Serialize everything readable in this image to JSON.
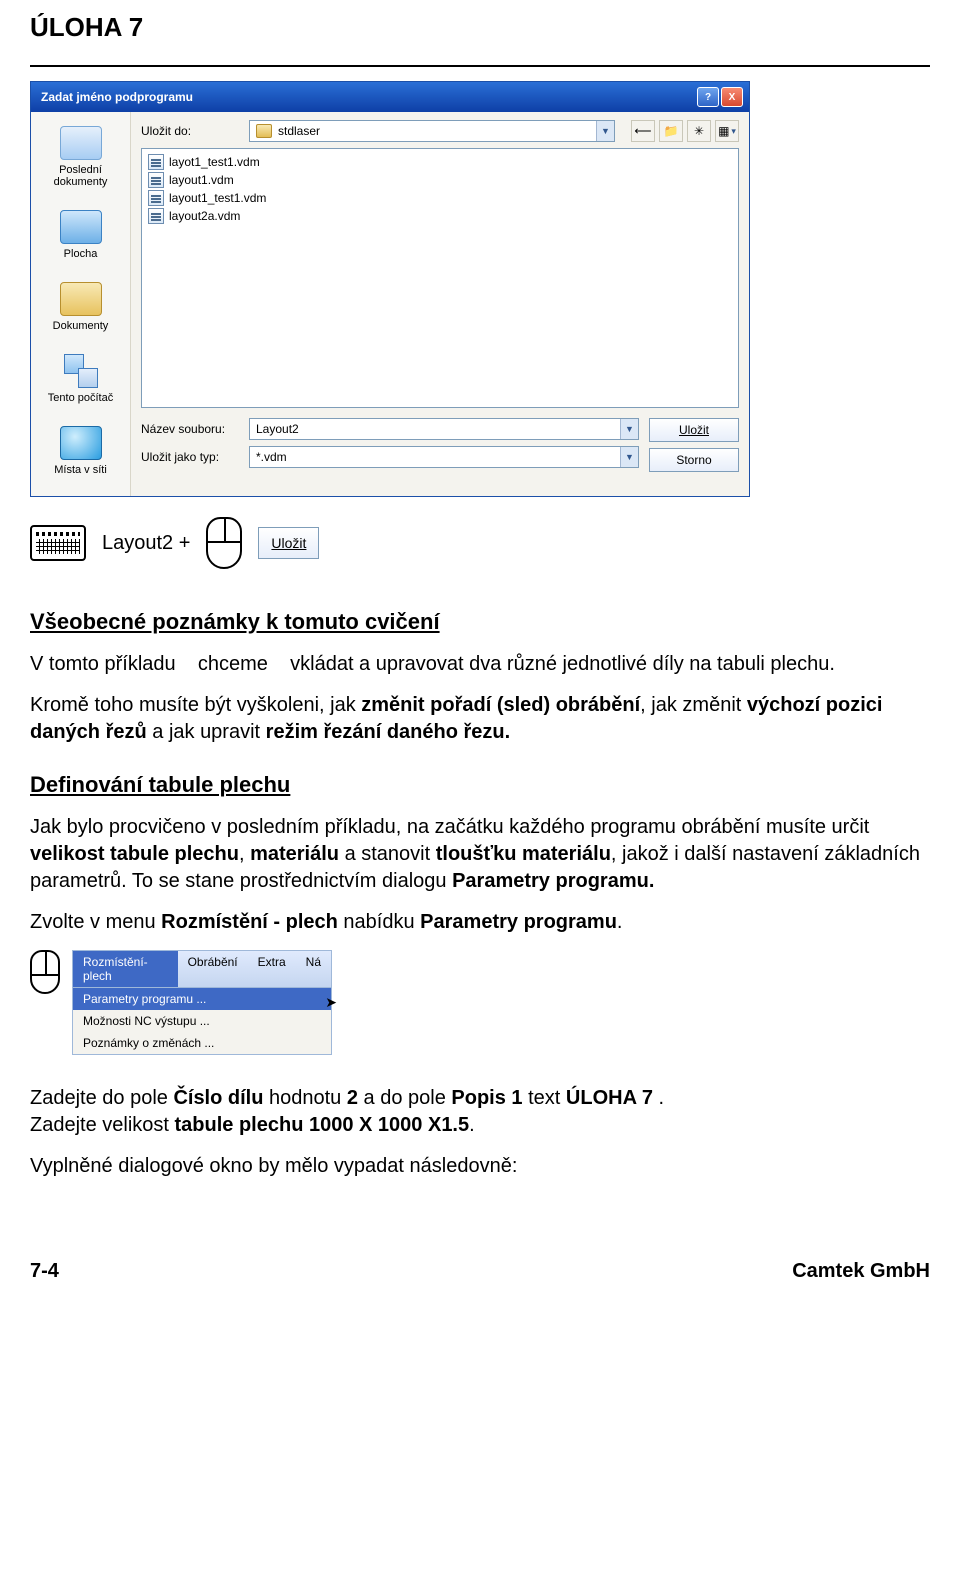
{
  "doc": {
    "page_title": "ÚLOHA 7",
    "page_num": "7-4",
    "publisher": "Camtek GmbH"
  },
  "dialog": {
    "title": "Zadat jméno podprogramu",
    "help_btn": "?",
    "close_btn": "X",
    "save_in_label": "Uložit do:",
    "save_in_value": "stdlaser",
    "places": {
      "recent": "Poslední dokumenty",
      "desktop": "Plocha",
      "docs": "Dokumenty",
      "computer": "Tento počítač",
      "network": "Místa v síti"
    },
    "files": [
      "layot1_test1.vdm",
      "layout1.vdm",
      "layout1_test1.vdm",
      "layout2a.vdm"
    ],
    "filename_label": "Název souboru:",
    "filename_value": "Layout2",
    "filetype_label": "Uložit jako typ:",
    "filetype_value": "*.vdm",
    "save_btn": "Uložit",
    "cancel_btn": "Storno"
  },
  "strip": {
    "text": "Layout2  +",
    "btn": "Uložit"
  },
  "text": {
    "h1": "Všeobecné poznámky k tomuto cvičení",
    "p1a": "V tomto příkladu",
    "p1b": "chceme",
    "p1c": "vkládat a upravovat dva různé jednotlivé díly na tabuli plechu.",
    "p2_pre": "Kromě toho musíte být vyškoleni, jak ",
    "p2_b1": "změnit pořadí (sled) obrábění",
    "p2_mid1": ", jak změnit ",
    "p2_b2": "výchozí pozici daných řezů",
    "p2_mid2": " a jak upravit ",
    "p2_b3": "režim řezání daného řezu.",
    "h2": "Definování tabule plechu",
    "p3_pre": "Jak bylo procvičeno v posledním příkladu,  na začátku každého programu obrábění musíte určit ",
    "p3_b1": "velikost tabule plechu",
    "p3_mid1": ", ",
    "p3_b2": "materiálu",
    "p3_mid2": " a stanovit ",
    "p3_b3": "tloušťku materiálu",
    "p3_mid3": ", jakož i další nastavení základních parametrů. To se stane prostřednictvím dialogu ",
    "p3_b4": "Parametry programu.",
    "p4_pre": "Zvolte v menu ",
    "p4_b1": "Rozmístění - plech",
    "p4_mid": " nabídku ",
    "p4_b2": "Parametry programu",
    "p4_post": ".",
    "p5_pre": "Zadejte do pole ",
    "p5_b1": "Číslo dílu",
    "p5_mid1": " hodnotu ",
    "p5_b2": "2",
    "p5_mid2": " a do pole ",
    "p5_b3": "Popis 1",
    "p5_mid3": "  text ",
    "p5_b4": "ÚLOHA 7",
    "p5_post": " .",
    "p6_pre": "Zadejte velikost ",
    "p6_b1": "tabule plechu 1000 X 1000 X1.5",
    "p6_post": ".",
    "p7": "Vyplněné dialogové okno by mělo vypadat následovně:"
  },
  "menu": {
    "tabs": [
      "Rozmístění-plech",
      "Obrábění",
      "Extra",
      "Ná"
    ],
    "items": [
      "Parametry programu ...",
      "Možnosti NC výstupu ...",
      "Poznámky o změnách ..."
    ]
  }
}
